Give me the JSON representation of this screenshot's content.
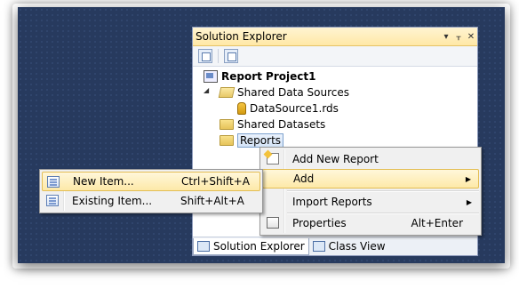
{
  "solution_explorer": {
    "title": "Solution Explorer",
    "title_controls": [
      "▾",
      "ᚁ",
      "✕"
    ],
    "tree": {
      "project": "Report Project1",
      "shared_data_sources": "Shared Data Sources",
      "data_source": "DataSource1.rds",
      "shared_datasets": "Shared Datasets",
      "reports": "Reports"
    },
    "bottom_tabs": [
      "Solution Explorer",
      "Class View"
    ]
  },
  "context_menu": {
    "items": [
      {
        "label": "Add New Report",
        "icon": "add-report-icon"
      },
      {
        "label": "Add",
        "submenu": true
      },
      {
        "label": "Import Reports",
        "submenu": true
      },
      {
        "label": "Properties",
        "shortcut": "Alt+Enter",
        "icon": "properties-icon"
      }
    ]
  },
  "submenu": {
    "items": [
      {
        "label": "New Item...",
        "shortcut": "Ctrl+Shift+A",
        "icon": "new-item-icon"
      },
      {
        "label": "Existing Item...",
        "shortcut": "Shift+Alt+A",
        "icon": "existing-item-icon"
      }
    ]
  }
}
